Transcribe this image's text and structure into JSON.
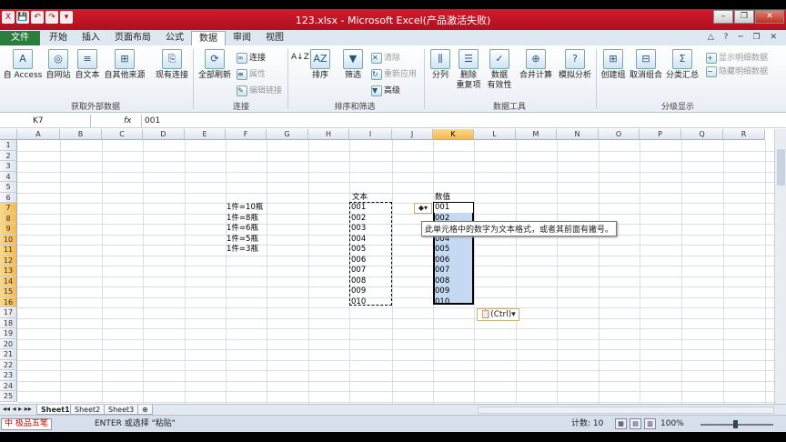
{
  "window": {
    "title": "123.xlsx - Microsoft Excel(产品激活失败)",
    "controls": {
      "minimize": "–",
      "restore": "❐",
      "close": "✕"
    }
  },
  "quick_access": [
    "X",
    "💾",
    "↶",
    "↷",
    "▾"
  ],
  "ribbon_tabs": [
    "文件",
    "开始",
    "插入",
    "页面布局",
    "公式",
    "数据",
    "审阅",
    "视图"
  ],
  "active_tab": "数据",
  "ribbon": {
    "external_data": {
      "buttons": [
        "自 Access",
        "自网站",
        "自文本",
        "自其他来源",
        "现有连接"
      ],
      "group": "获取外部数据"
    },
    "connections": {
      "refresh": "全部刷新",
      "small": [
        "连接",
        "属性",
        "编辑链接"
      ],
      "group": "连接"
    },
    "sort_filter": {
      "sort_az": "A↓Z",
      "sort": "排序",
      "filter": "筛选",
      "small": [
        "清除",
        "重新应用",
        "高级"
      ],
      "group": "排序和筛选"
    },
    "data_tools": {
      "buttons": [
        "分列",
        "删除\n重复项",
        "数据\n有效性",
        "合并计算",
        "模拟分析"
      ],
      "group": "数据工具"
    },
    "outline": {
      "buttons": [
        "创建组",
        "取消组合",
        "分类汇总"
      ],
      "small": [
        "显示明细数据",
        "隐藏明细数据"
      ],
      "group": "分级显示"
    }
  },
  "formula_bar": {
    "name_box": "K7",
    "fx": "fx",
    "value": "001"
  },
  "columns": [
    "A",
    "B",
    "C",
    "D",
    "E",
    "F",
    "G",
    "H",
    "I",
    "J",
    "K",
    "L",
    "M",
    "N",
    "O",
    "P",
    "Q",
    "R"
  ],
  "rows": [
    "1",
    "2",
    "3",
    "4",
    "5",
    "6",
    "7",
    "8",
    "9",
    "10",
    "11",
    "12",
    "13",
    "14",
    "15",
    "16",
    "17",
    "18",
    "19",
    "20",
    "21",
    "22",
    "23",
    "24",
    "25",
    "26",
    "27"
  ],
  "cells": {
    "F_col": [
      "1件=10瓶",
      "1件=8瓶",
      "1件=6瓶",
      "1件=5瓶",
      "1件=3瓶"
    ],
    "I6": "文本",
    "I_col": [
      "001",
      "002",
      "003",
      "004",
      "005",
      "006",
      "007",
      "008",
      "009",
      "010"
    ],
    "K6": "数值",
    "K_col": [
      "001",
      "002",
      "003",
      "004",
      "005",
      "006",
      "007",
      "008",
      "009",
      "010"
    ]
  },
  "error_tooltip": "此单元格中的数字为文本格式，或者其前面有撇号。",
  "paste_options": "(Ctrl)",
  "sheets": [
    "Sheet1",
    "Sheet2",
    "Sheet3"
  ],
  "status": {
    "ime": "中 极品五笔",
    "message": "ENTER 或选择 \"粘贴\"",
    "count": "计数: 10",
    "zoom": "100%"
  }
}
